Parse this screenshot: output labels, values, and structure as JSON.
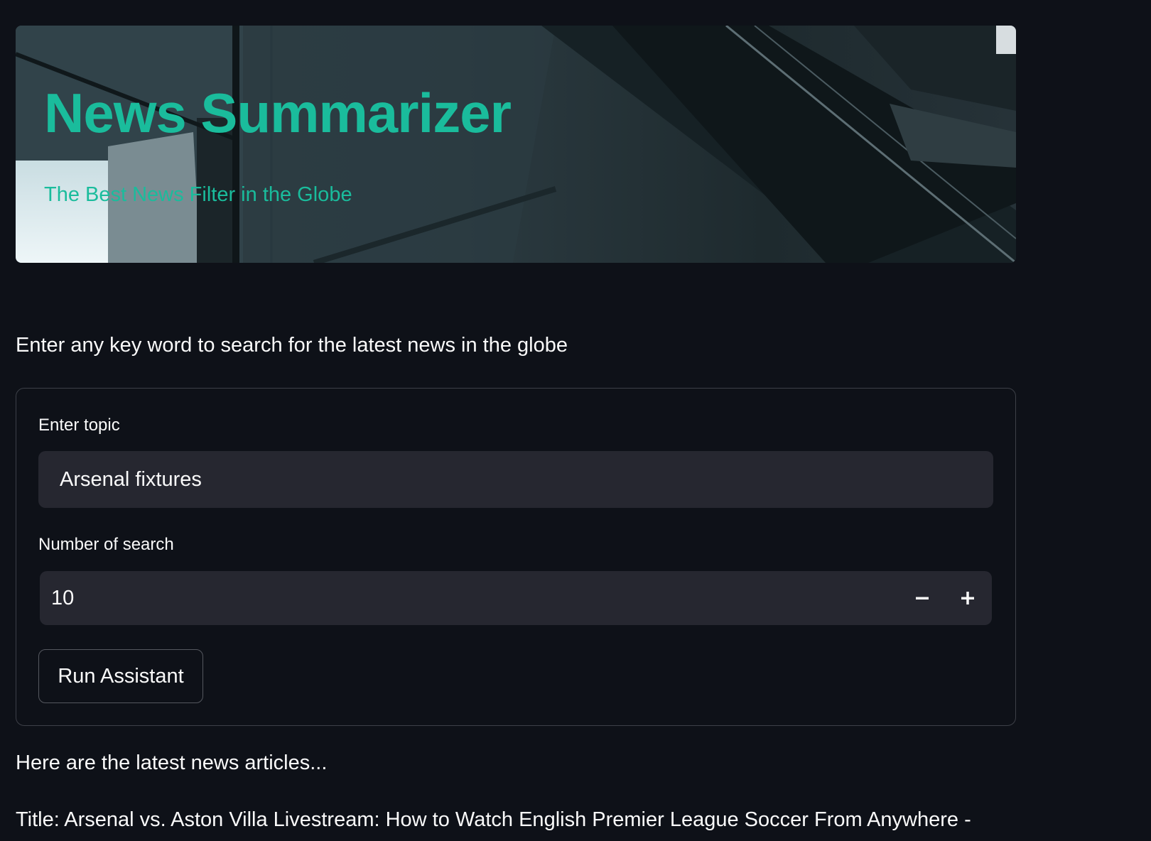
{
  "header": {
    "title": "News Summarizer",
    "subtitle": "The Best News Filter in the Globe"
  },
  "intro": "Enter any key word to search for the latest news in the globe",
  "form": {
    "topic_label": "Enter topic",
    "topic_value": "Arsenal fixtures",
    "count_label": "Number of search",
    "count_value": "10",
    "decrement_icon": "minus-icon",
    "increment_icon": "plus-icon",
    "run_label": "Run Assistant"
  },
  "results": {
    "heading": "Here are the latest news articles...",
    "first_title": "Title: Arsenal vs. Aston Villa Livestream: How to Watch English Premier League Soccer From Anywhere -"
  },
  "colors": {
    "accent": "#1abc9c",
    "background": "#0e1118",
    "input_bg": "#262730"
  }
}
